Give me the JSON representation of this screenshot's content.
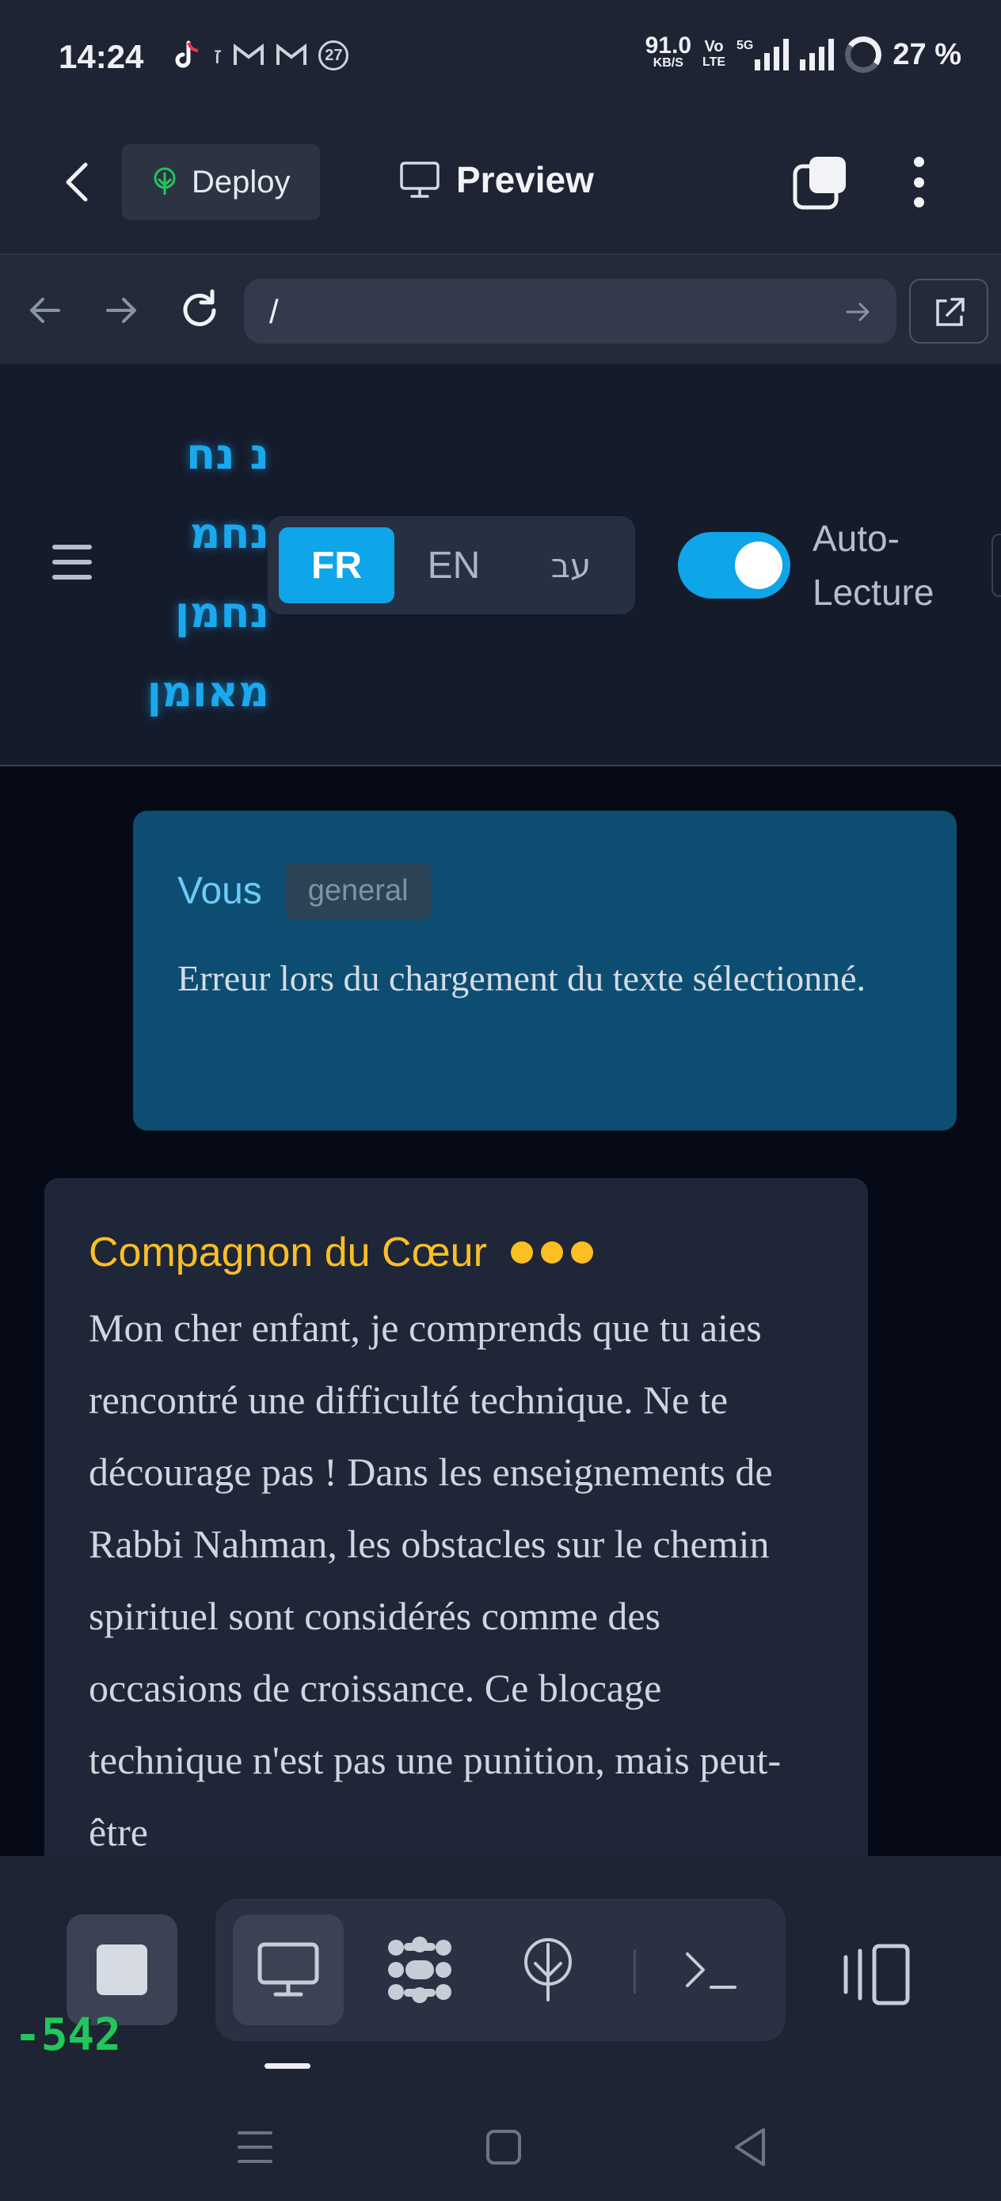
{
  "status_bar": {
    "time": "14:24",
    "notification_badge": "27",
    "net_speed": "91.0",
    "net_unit": "KB/S",
    "volte": "Vo",
    "volte_sub": "LTE",
    "net_type": "5G",
    "battery": "27 %"
  },
  "app_bar": {
    "deploy_label": "Deploy",
    "preview_label": "Preview"
  },
  "browser": {
    "url": "/"
  },
  "header": {
    "logo_lines": [
      "נ נח",
      "נחמ",
      "נחמן",
      "מאומן"
    ],
    "languages": [
      {
        "label": "FR",
        "active": true
      },
      {
        "label": "EN",
        "active": false
      },
      {
        "label": "עב",
        "active": false
      }
    ],
    "auto_read_label_1": "Auto-",
    "auto_read_label_2": "Lecture",
    "auto_read_on": true
  },
  "chat": {
    "user_message": {
      "author": "Vous",
      "tag": "general",
      "text": "Erreur lors du chargement du texte sélectionné."
    },
    "bot_message": {
      "author": "Compagnon du Cœur",
      "text": "Mon cher enfant, je comprends que tu aies rencontré une difficulté technique. Ne te décourage pas ! Dans les enseignements de Rabbi Nahman, les obstacles sur le chemin spirituel sont considérés comme des occasions de croissance. Ce blocage technique n'est pas une punition, mais peut-être"
    }
  },
  "toolbar": {
    "counter": "-542"
  },
  "colors": {
    "accent": "#0ea5e9",
    "bot_name": "#fbbf24",
    "user_bubble": "#0d4d72",
    "counter": "#22c55e"
  }
}
